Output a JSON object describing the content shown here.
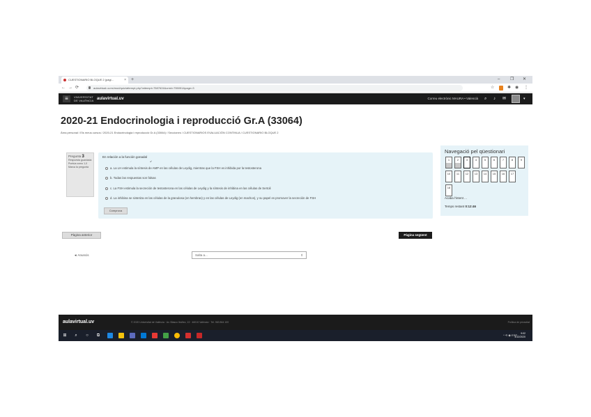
{
  "browser": {
    "tab_title": "CUESTIONARIO BLOQUE 2 (pàgi...",
    "tab_close": "×",
    "new_tab": "+",
    "url": "aulavirtual.uv.es/mod/quiz/attempt.php?attempt=7587624&cmid=755051&page=3",
    "win_min": "–",
    "win_max": "❐",
    "win_close": "✕"
  },
  "site": {
    "uv_logo_line1": "VNIVERSITAT",
    "uv_logo_line2": "DE VALÈNCIA",
    "brand": "aulavirtual.uv",
    "user_text": "Correu electrònic  MAURA  •  Valencià"
  },
  "page": {
    "title": "2020-21 Endocrinologia i reproducció Gr.A (33064)",
    "breadcrumb": "Àrea personal  /  Els meus cursos  /  2020-21 Endocrinologia i reproducció Gr.A (33064)  /  Secciones  /  CUESTIONARIOS EVALUACIÓN CONTINUA  /  CUESTIONARIO BLOQUE 2"
  },
  "question": {
    "label": "Pregunta",
    "number": "3",
    "status": "Respuesta guardada",
    "points": "Puntúa como 1,0",
    "flag": "Marca la pregunta",
    "text": "En relación a la función gonadal",
    "options": [
      "a. La LH estimula la síntesis de AMP en las células de Leydig, mientras que la FSH es inhibida por la testosterona",
      "b. Todas las respuestas son falsas",
      "c. La FSH estimula la secreción de testosterona en las células de Leydig y la síntesis de inhibina en las células de Sertoli",
      "d. La inhibina se sintetiza en las células de la granulosa (en hembras) y en las células de Leydig (en machos), y su papel es promover la secreción de FSH"
    ],
    "check_label": "Comprova"
  },
  "quiz_nav": {
    "title": "Navegació pel qüestionari",
    "questions": [
      "1",
      "2",
      "3",
      "4",
      "5",
      "6",
      "7",
      "8",
      "9",
      "10",
      "11",
      "12",
      "13",
      "14",
      "15",
      "16",
      "17",
      "18"
    ],
    "finish_label": "Acaba l'intent ...",
    "timer_label": "Temps restant",
    "timer_value": "0:12:46"
  },
  "buttons": {
    "prev": "Pàgina anterior",
    "next": "Pàgina següent"
  },
  "jump": {
    "prev_link": "◄ Anuncis",
    "select_placeholder": "Salta a...",
    "caret": "⇕"
  },
  "footer": {
    "brand": "aulavirtual.uv",
    "text": "© 2020 Universitat de València · Av. Blasco Ibáñez, 13 · 46010 València · Tel. 963 864 100",
    "right": "Política de privacitat"
  },
  "taskbar": {
    "tray_text": "^  ⟲  ◉  ESP",
    "time": "9:02",
    "date": "3/12/2020"
  },
  "colors": {
    "header": "#1b1b1b",
    "question_bg": "#e6f3f8",
    "taskbar": "#1a1f2b"
  }
}
